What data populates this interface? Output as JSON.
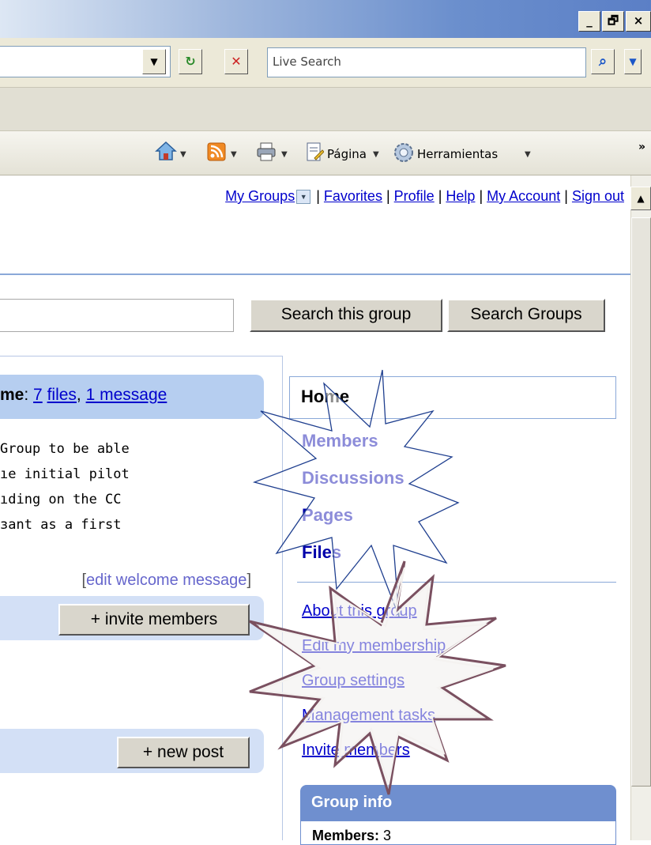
{
  "window": {
    "minimize": "_",
    "restore": "🗗",
    "close": "×"
  },
  "toolbar": {
    "search_placeholder": "Live Search",
    "dropdown_glyph": "▼",
    "refresh_glyph": "↻",
    "stop_glyph": "✕",
    "search_glyph": "⌕",
    "more_glyph": "»"
  },
  "commandbar": {
    "page_label": "Página",
    "tools_label": "Herramientas"
  },
  "toplinks": [
    "My Groups",
    "Favorites",
    "Profile",
    "Help",
    "My Account",
    "Sign out"
  ],
  "toplinks_sep": "|",
  "search": {
    "search_group_button": "Search this group",
    "search_groups_button": "Search Groups"
  },
  "welcome": {
    "title_prefix": "me",
    "files_count": "7",
    "files_word": "files",
    "comma": ", ",
    "message_link": "1 message",
    "lines": [
      "Group to be able",
      "ıe initial pilot",
      "ıding on the CC",
      "ɜant as a first"
    ],
    "edit_link": "edit welcome message"
  },
  "buttons": {
    "invite": "+ invite members",
    "new_post": "+ new post"
  },
  "nav": {
    "home": "Home",
    "items": [
      "Members",
      "Discussions",
      "Pages",
      "Files"
    ],
    "sub_items": [
      "About this group",
      "Edit my membership",
      "Group settings",
      "Management tasks",
      "Invite members"
    ]
  },
  "group_info": {
    "title": "Group info",
    "members_label": "Members:",
    "members_value": "3"
  },
  "colors": {
    "link": "#0000cc",
    "accent": "#6f8fcf",
    "tab": "#b6cef0"
  }
}
